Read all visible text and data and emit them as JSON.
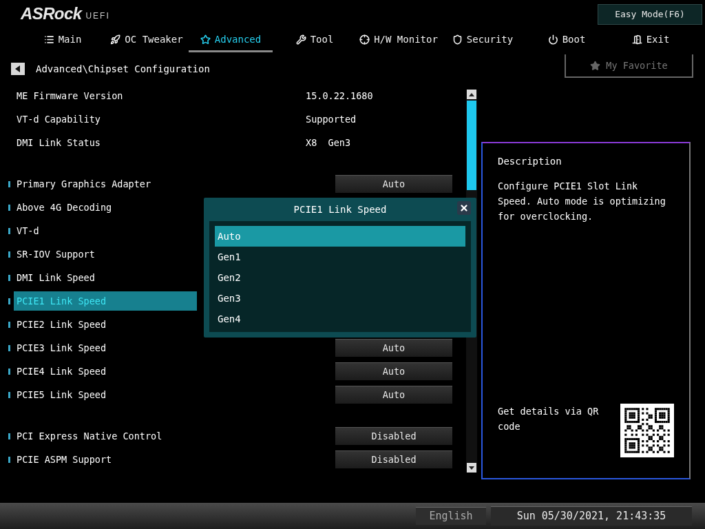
{
  "logo": {
    "brand": "ASRock",
    "product": "UEFI"
  },
  "easy_mode_button": "Easy Mode(F6)",
  "tabs": [
    {
      "label": "Main",
      "selected": false
    },
    {
      "label": "OC Tweaker",
      "selected": false
    },
    {
      "label": "Advanced",
      "selected": true
    },
    {
      "label": "Tool",
      "selected": false
    },
    {
      "label": "H/W Monitor",
      "selected": false
    },
    {
      "label": "Security",
      "selected": false
    },
    {
      "label": "Boot",
      "selected": false
    },
    {
      "label": "Exit",
      "selected": false
    }
  ],
  "breadcrumb": "Advanced\\Chipset Configuration",
  "favorite_button": "My Favorite",
  "info_rows": [
    {
      "label": "ME Firmware Version",
      "value": "15.0.22.1680"
    },
    {
      "label": "VT-d Capability",
      "value": "Supported"
    },
    {
      "label": "DMI Link Status",
      "value": "X8  Gen3"
    }
  ],
  "setting_groups": [
    [
      {
        "label": "Primary Graphics Adapter",
        "value": "Auto",
        "selected": false
      },
      {
        "label": "Above 4G Decoding",
        "selected": false
      },
      {
        "label": "VT-d",
        "selected": false
      },
      {
        "label": "SR-IOV Support",
        "selected": false
      },
      {
        "label": "DMI Link Speed",
        "selected": false
      },
      {
        "label": "PCIE1 Link Speed",
        "selected": true
      },
      {
        "label": "PCIE2 Link Speed",
        "selected": false
      },
      {
        "label": "PCIE3 Link Speed",
        "value": "Auto",
        "selected": false
      },
      {
        "label": "PCIE4 Link Speed",
        "value": "Auto",
        "selected": false
      },
      {
        "label": "PCIE5 Link Speed",
        "value": "Auto",
        "selected": false
      }
    ],
    [
      {
        "label": "PCI Express Native Control",
        "value": "Disabled",
        "selected": false
      },
      {
        "label": "PCIE ASPM Support",
        "value": "Disabled",
        "selected": false
      }
    ]
  ],
  "description": {
    "title": "Description",
    "text": "Configure PCIE1 Slot Link Speed. Auto mode is optimizing for overclocking.",
    "qr_caption": "Get details via QR code"
  },
  "dialog": {
    "title": "PCIE1 Link Speed",
    "options": [
      {
        "label": "Auto",
        "selected": true
      },
      {
        "label": "Gen1",
        "selected": false
      },
      {
        "label": "Gen2",
        "selected": false
      },
      {
        "label": "Gen3",
        "selected": false
      },
      {
        "label": "Gen4",
        "selected": false
      }
    ]
  },
  "status_bar": {
    "language": "English",
    "datetime": "Sun 05/30/2021, 21:43:35"
  }
}
